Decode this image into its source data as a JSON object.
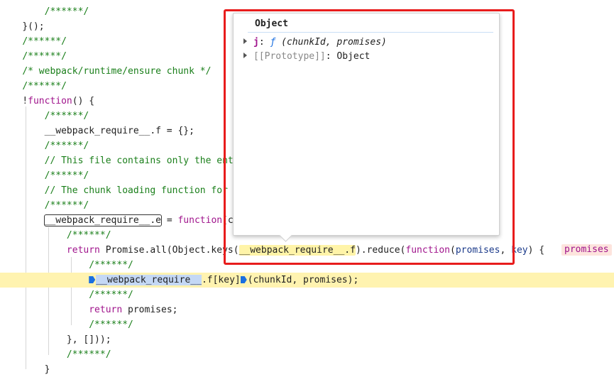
{
  "code": {
    "l1": "/******/",
    "l2": "}();",
    "l3": "/******/",
    "l4": "/******/",
    "l5": "/* webpack/runtime/ensure chunk */",
    "l6": "/******/",
    "l7_bang": "!",
    "l7_kw": "function",
    "l7_rest": "() {",
    "l8": "/******/",
    "l9": "__webpack_require__.f = {};",
    "l10": "/******/",
    "l11": "// This file contains only the ent",
    "l12": "/******/",
    "l13": "// The chunk loading function for",
    "l14": "/******/",
    "l15_req": "__webpack_require__.e",
    "l15_eq": " = ",
    "l15_kw": "function",
    "l15_tail": "(c",
    "l16": "/******/",
    "l17_return": "return",
    "l17_a": " Promise.all(Object.keys(",
    "l17_hl": "__webpack_require__.f",
    "l17_b": ").reduce(",
    "l17_kw": "function",
    "l17_c": "(",
    "l17_p1": "promises",
    "l17_d": ", ",
    "l17_p2": "key",
    "l17_e": ") {",
    "l17_inline": "promises",
    "l18": "/******/",
    "l19_sel": "__webpack_require__",
    "l19_rest": ".f[key]",
    "l19_tail": "(chunkId, promises);",
    "l20": "/******/",
    "l21_return": "return",
    "l21_rest": " promises;",
    "l22": "/******/",
    "l23": "}, []));",
    "l24": "/******/",
    "l25": "}"
  },
  "popover": {
    "title": "Object",
    "prop_key": "j",
    "prop_colon": ": ",
    "prop_f": "ƒ",
    "prop_sig": " (chunkId, promises)",
    "proto_key": "[[Prototype]]",
    "proto_colon": ": ",
    "proto_val": "Object"
  },
  "colors": {
    "highlight_box": "#e81c1c",
    "paused_line": "#fff3b0"
  }
}
